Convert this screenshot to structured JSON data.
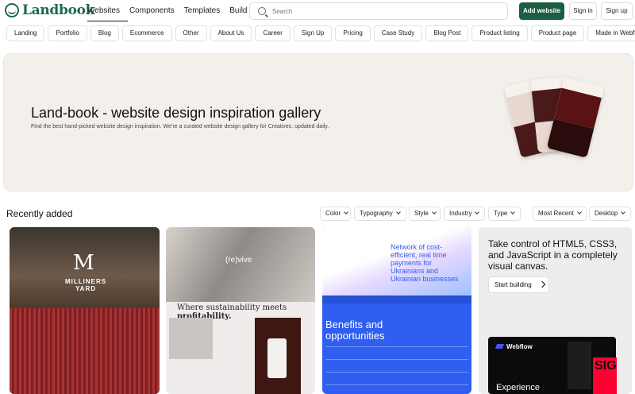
{
  "header": {
    "logo": "Landbook",
    "nav": [
      "Websites",
      "Components",
      "Templates",
      "Build"
    ],
    "search_placeholder": "Search",
    "add_website": "Add website",
    "sign_in": "Sign in",
    "sign_up": "Sign up"
  },
  "categories": [
    "Landing",
    "Portfolio",
    "Blog",
    "Ecommerce",
    "Other",
    "About Us",
    "Career",
    "Sign Up",
    "Pricing",
    "Case Study",
    "Blog Post",
    "Product listing",
    "Product page",
    "Made in Webflow"
  ],
  "hero": {
    "title": "Land-book - website design inspiration gallery",
    "subtitle": "Find the best hand-picked website design inspiration. We’re a curated website design gallery for Creatives. updated daily."
  },
  "recent": {
    "title": "Recently added",
    "filters": [
      "Color",
      "Typography",
      "Style",
      "Industry",
      "Type",
      "Most Recent",
      "Desktop"
    ]
  },
  "cards": {
    "c1": {
      "mark": "M",
      "name_line1": "MILLINERS",
      "name_line2": "YARD"
    },
    "c2": {
      "logo": "(re)vive",
      "tagline_a": "Where sustainability meets ",
      "tagline_b": "profitability."
    },
    "c3": {
      "headline": "Network of cost-efficient, real time payments for Ukrainians and Ukrainian businesses",
      "benefits": "Benefits and opportunities"
    },
    "c4": {
      "text": "Take control of HTML5, CSS3, and JavaScript in a completely visual canvas.",
      "button": "Start building",
      "brand": "Webflow",
      "bottom": "Experience",
      "sig": "SIG"
    }
  },
  "colors": {
    "brand": "#1a5e44",
    "hero_bg": "#f3f0eb",
    "blue": "#2f5ef0"
  }
}
